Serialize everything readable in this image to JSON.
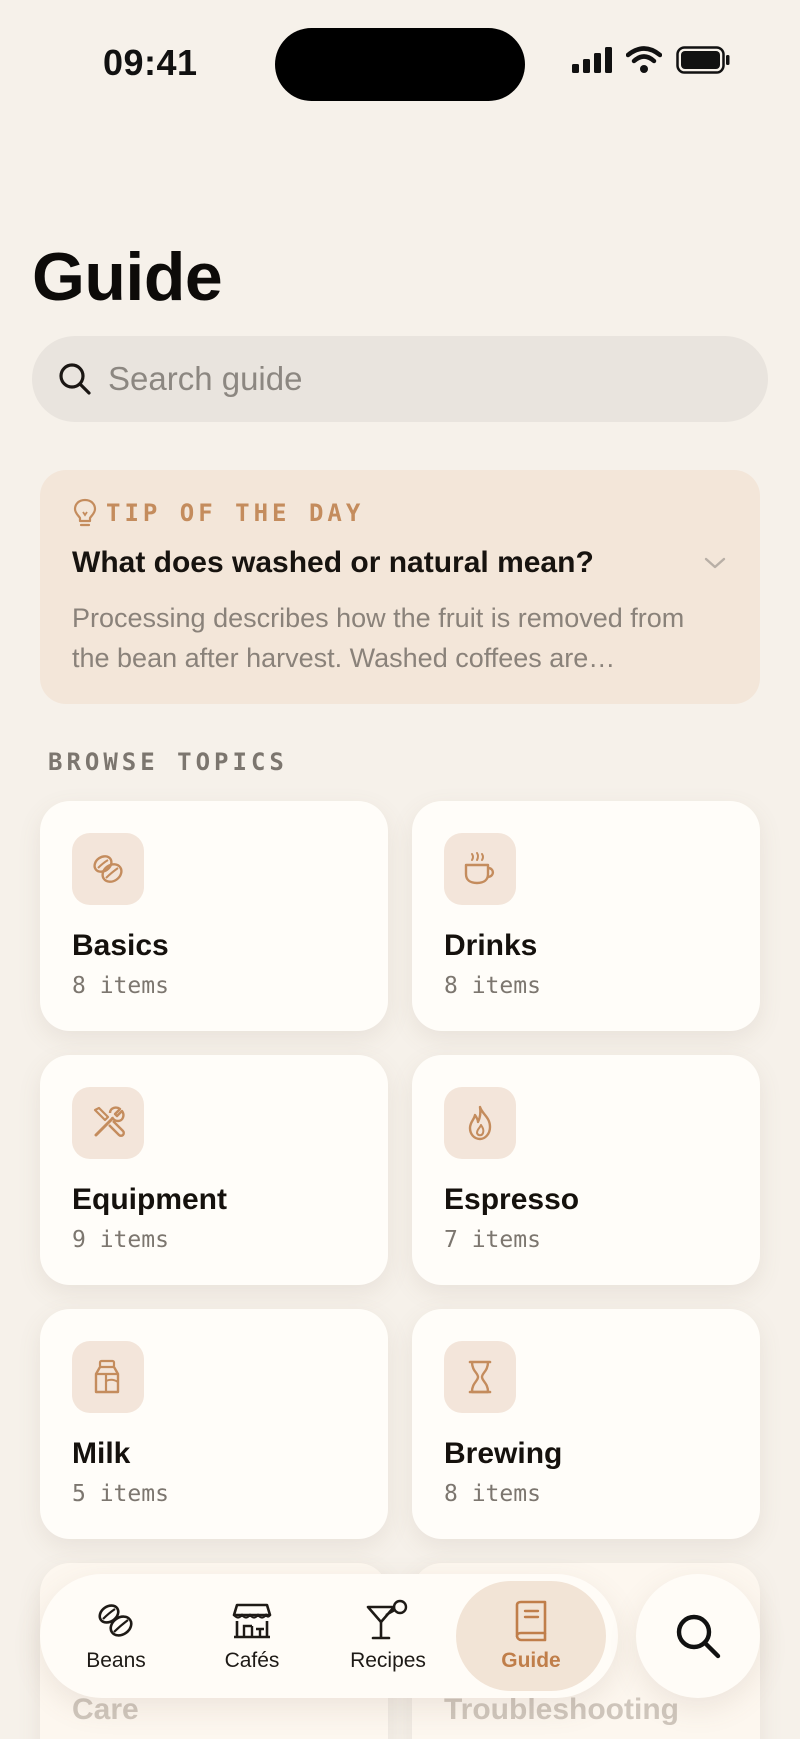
{
  "status": {
    "time": "09:41"
  },
  "page": {
    "title": "Guide"
  },
  "search": {
    "placeholder": "Search guide"
  },
  "tip": {
    "eyebrow": "TIP OF THE DAY",
    "question": "What does washed or natural mean?",
    "answer": "Processing describes how the fruit is removed from the bean after harvest. Washed coffees are…"
  },
  "browse": {
    "label": "BROWSE TOPICS",
    "topics": [
      {
        "name": "Basics",
        "count": "8 items",
        "icon": "coffee-bean-icon"
      },
      {
        "name": "Drinks",
        "count": "8 items",
        "icon": "coffee-cup-icon"
      },
      {
        "name": "Equipment",
        "count": "9 items",
        "icon": "tools-icon"
      },
      {
        "name": "Espresso",
        "count": "7 items",
        "icon": "flame-icon"
      },
      {
        "name": "Milk",
        "count": "5 items",
        "icon": "milk-carton-icon"
      },
      {
        "name": "Brewing",
        "count": "8 items",
        "icon": "hourglass-icon"
      },
      {
        "name": "Care"
      },
      {
        "name": "Troubleshooting"
      }
    ]
  },
  "tabs": [
    {
      "label": "Beans",
      "icon": "beans-icon"
    },
    {
      "label": "Cafés",
      "icon": "cafe-icon"
    },
    {
      "label": "Recipes",
      "icon": "cocktail-icon"
    },
    {
      "label": "Guide",
      "icon": "book-icon",
      "active": true
    }
  ],
  "colors": {
    "accent": "#c48c5d",
    "background": "#f6f1ea",
    "card": "#fffdf9",
    "icon_bg": "#f3e5da"
  }
}
